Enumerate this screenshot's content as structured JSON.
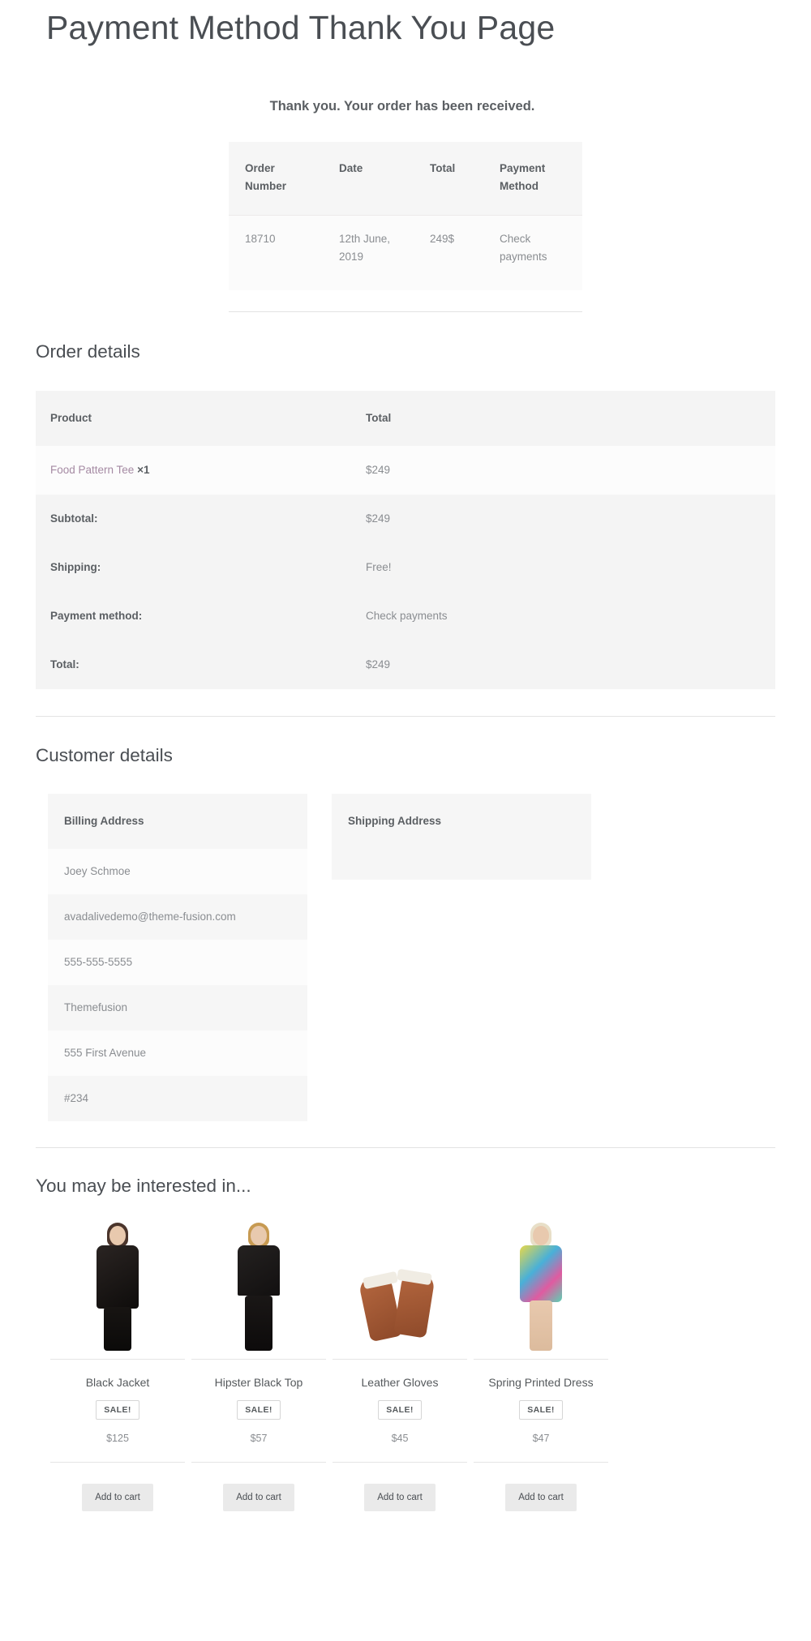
{
  "page": {
    "title": "Payment Method Thank You Page",
    "thank_you_message": "Thank you. Your order has been received."
  },
  "order_overview": {
    "headers": [
      "Order Number",
      "Date",
      "Total",
      "Payment Method"
    ],
    "row": {
      "order_number": "18710",
      "date": "12th June, 2019",
      "total": "249$",
      "payment_method": "Check payments"
    }
  },
  "order_details": {
    "heading": "Order details",
    "headers": {
      "product": "Product",
      "total": "Total"
    },
    "items": [
      {
        "name": "Food Pattern Tee",
        "qty": "×1",
        "total": "$249"
      }
    ],
    "summary": [
      {
        "label": "Subtotal:",
        "value": "$249"
      },
      {
        "label": "Shipping:",
        "value": "Free!"
      },
      {
        "label": "Payment method:",
        "value": "Check payments"
      },
      {
        "label": "Total:",
        "value": "$249"
      }
    ]
  },
  "customer_details": {
    "heading": "Customer details",
    "billing": {
      "title": "Billing Address",
      "lines": [
        "Joey Schmoe",
        "avadalivedemo@theme-fusion.com",
        "555-555-5555",
        "Themefusion",
        "555 First Avenue",
        "#234"
      ]
    },
    "shipping": {
      "title": "Shipping Address",
      "lines": []
    }
  },
  "upsells": {
    "heading": "You may be interested in...",
    "add_to_cart_label": "Add to cart",
    "sale_label": "SALE!",
    "products": [
      {
        "name": "Black Jacket",
        "price": "$125",
        "on_sale": true,
        "image": "black-jacket-photo"
      },
      {
        "name": "Hipster Black Top",
        "price": "$57",
        "on_sale": true,
        "image": "hipster-black-top-photo"
      },
      {
        "name": "Leather Gloves",
        "price": "$45",
        "on_sale": true,
        "image": "leather-gloves-photo"
      },
      {
        "name": "Spring Printed Dress",
        "price": "$47",
        "on_sale": true,
        "image": "spring-printed-dress-photo"
      }
    ]
  },
  "colors": {
    "heading_text": "#4a4e53",
    "body_text": "#8a8d91",
    "strong_text": "#5b5f63",
    "product_link": "#a58aa3",
    "table_header_bg": "#f4f4f4",
    "row_bg": "#fcfcfc",
    "button_bg": "#eaeaea"
  }
}
